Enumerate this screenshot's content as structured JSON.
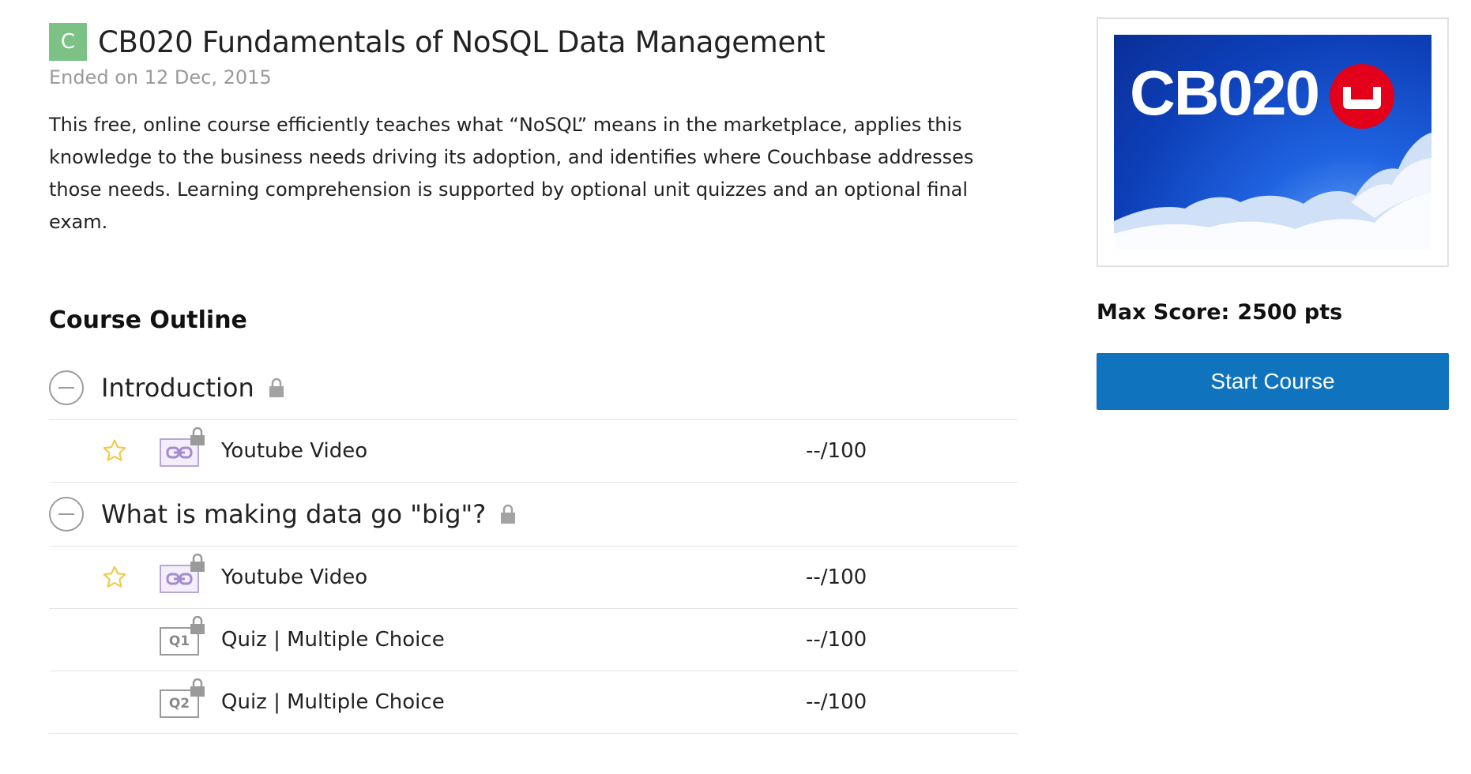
{
  "course": {
    "badge_letter": "C",
    "title": "CB020 Fundamentals of NoSQL Data Management",
    "status": "Ended on 12 Dec, 2015",
    "description": "This free, online course efficiently teaches what “NoSQL” means in the marketplace, applies this knowledge to the business needs driving its adoption, and identifies where Couchbase addresses those needs. Learning comprehension is supported by optional unit quizzes and an optional final exam."
  },
  "outline": {
    "heading": "Course Outline",
    "sections": [
      {
        "title": "Introduction",
        "items": [
          {
            "type": "video",
            "label": "Youtube Video",
            "score": "--/100",
            "starred": true
          }
        ]
      },
      {
        "title": "What is making data go \"big\"?",
        "items": [
          {
            "type": "video",
            "label": "Youtube Video",
            "score": "--/100",
            "starred": true
          },
          {
            "type": "quiz",
            "quiz_label": "Q1",
            "label": "Quiz | Multiple Choice",
            "score": "--/100",
            "starred": false
          },
          {
            "type": "quiz",
            "quiz_label": "Q2",
            "label": "Quiz | Multiple Choice",
            "score": "--/100",
            "starred": false
          }
        ]
      }
    ]
  },
  "sidebar": {
    "thumbnail_text": "CB020",
    "max_score_label": "Max Score:",
    "max_score_value": "2500 pts",
    "start_button_label": "Start Course"
  },
  "colors": {
    "badge": "#7cc285",
    "start_button": "#0f73be",
    "thumbnail_bg": "#1f63e0",
    "logo_red": "#e2001a"
  }
}
